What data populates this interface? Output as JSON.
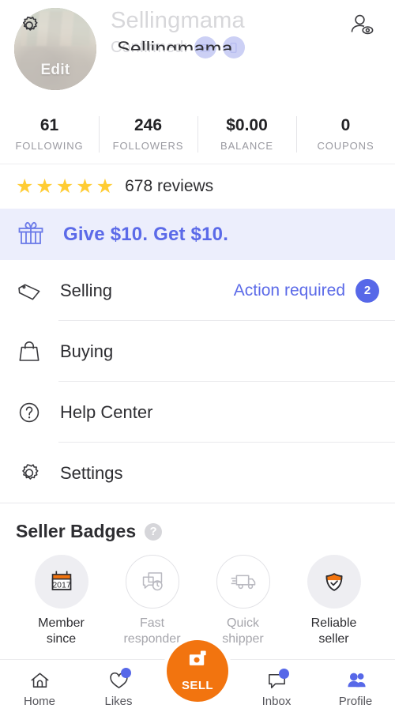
{
  "header": {
    "username_ghost": "Sellingmama",
    "username_fore": "Sellingmama",
    "confirmed_label": "Confirmed:",
    "confirmed_chips": [
      "email-icon",
      "phone-icon"
    ],
    "avatar_edit_label": "Edit",
    "gear_icon": "gear-icon",
    "viewer_icon": "profile-views-icon"
  },
  "stats": [
    {
      "value": "61",
      "label": "FOLLOWING"
    },
    {
      "value": "246",
      "label": "FOLLOWERS"
    },
    {
      "value": "$0.00",
      "label": "BALANCE"
    },
    {
      "value": "0",
      "label": "COUPONS"
    }
  ],
  "reviews": {
    "stars": 5,
    "star_glyph": "★",
    "text": "678 reviews"
  },
  "referral": {
    "icon": "gift-icon",
    "text": "Give $10. Get $10."
  },
  "menu": [
    {
      "icon": "tag-icon",
      "label": "Selling",
      "action_text": "Action required",
      "badge": "2"
    },
    {
      "icon": "bag-icon",
      "label": "Buying",
      "action_text": "",
      "badge": ""
    },
    {
      "icon": "question-icon",
      "label": "Help Center",
      "action_text": "",
      "badge": ""
    },
    {
      "icon": "gear-icon",
      "label": "Settings",
      "action_text": "",
      "badge": ""
    }
  ],
  "badges_section": {
    "title": "Seller Badges",
    "help_glyph": "?",
    "items": [
      {
        "icon": "calendar-2017-icon",
        "label": "Member",
        "sub": "since",
        "active": true
      },
      {
        "icon": "chat-clock-icon",
        "label": "Fast",
        "sub": "responder",
        "active": false
      },
      {
        "icon": "truck-icon",
        "label": "Quick",
        "sub": "shipper",
        "active": false
      },
      {
        "icon": "shield-check-icon",
        "label": "Reliable",
        "sub": "seller",
        "active": true
      }
    ]
  },
  "bottom_nav": [
    {
      "icon": "home-icon",
      "label": "Home",
      "dot": false,
      "active": false
    },
    {
      "icon": "heart-icon",
      "label": "Likes",
      "dot": true,
      "active": false
    },
    {
      "icon": "camera-icon",
      "label": "SELL",
      "dot": false,
      "active": false
    },
    {
      "icon": "inbox-icon",
      "label": "Inbox",
      "dot": true,
      "active": false
    },
    {
      "icon": "people-icon",
      "label": "Profile",
      "dot": false,
      "active": true
    }
  ],
  "colors": {
    "accent_blue": "#5768e8",
    "accent_orange": "#f2740f",
    "star_yellow": "#FFCC33",
    "banner_bg": "#eceefc"
  }
}
